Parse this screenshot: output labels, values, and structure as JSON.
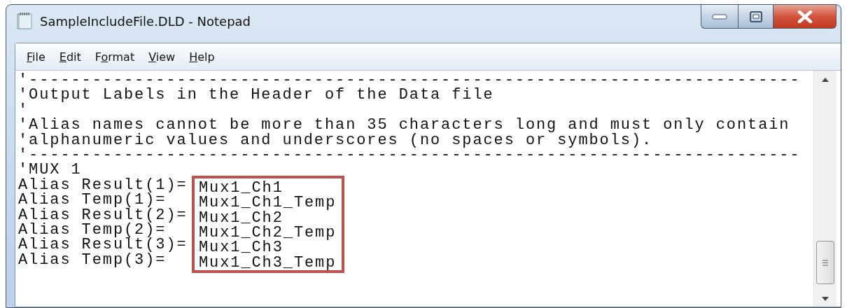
{
  "window": {
    "title": "SampleIncludeFile.DLD - Notepad"
  },
  "menu": [
    {
      "key": "F",
      "post": "ile"
    },
    {
      "key": "E",
      "post": "dit"
    },
    {
      "pre": "F",
      "key": "o",
      "post": "rmat"
    },
    {
      "key": "V",
      "post": "iew"
    },
    {
      "key": "H",
      "post": "elp"
    }
  ],
  "editor": {
    "lines": [
      "'-------------------------------------------------------------------------",
      "'Output Labels in the Header of the Data file",
      "'",
      "'Alias names cannot be more than 35 characters long and must only contain",
      "'alphanumeric values and underscores (no spaces or symbols).",
      "'-------------------------------------------------------------------------",
      "'MUX 1"
    ],
    "aliases": [
      {
        "label": "Alias Result(1)=",
        "value": "Mux1_Ch1"
      },
      {
        "label": "Alias Temp(1)=",
        "value": "Mux1_Ch1_Temp"
      },
      {
        "label": "Alias Result(2)=",
        "value": "Mux1_Ch2"
      },
      {
        "label": "Alias Temp(2)=",
        "value": "Mux1_Ch2_Temp"
      },
      {
        "label": "Alias Result(3)=",
        "value": "Mux1_Ch3"
      },
      {
        "label": "Alias Temp(3)=",
        "value": "Mux1_Ch3_Temp"
      }
    ]
  }
}
